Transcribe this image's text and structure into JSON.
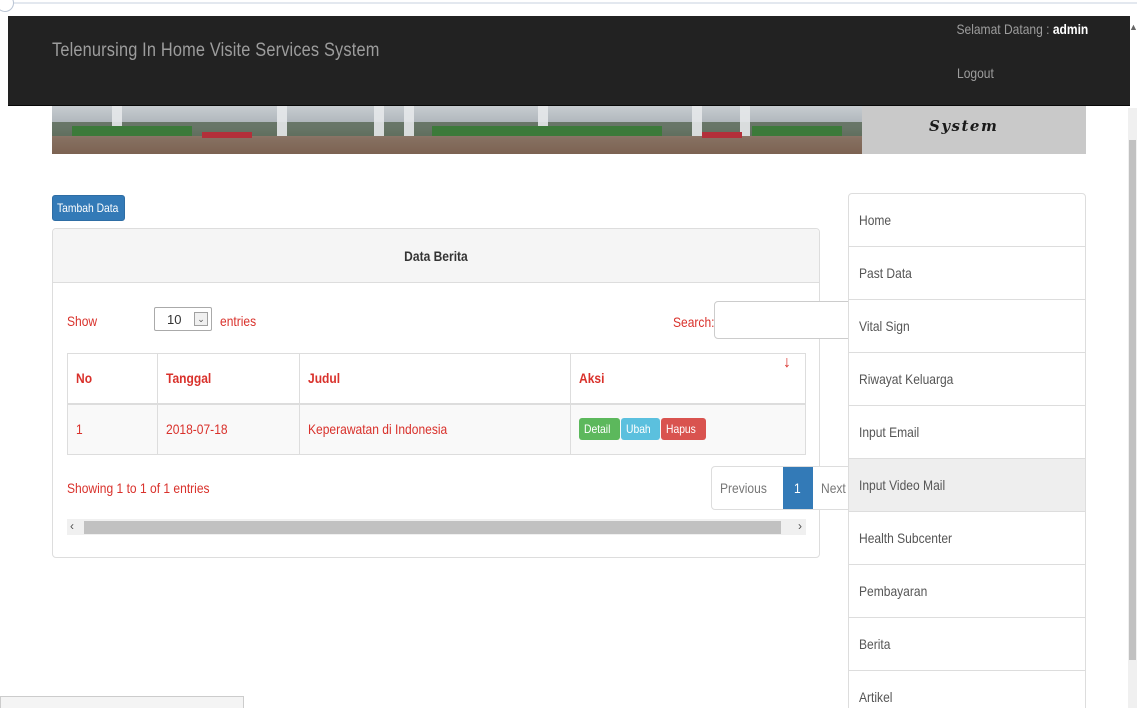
{
  "header": {
    "brand": "Telenursing In Home Visite Services System",
    "welcome_prefix": "Selamat Datang :",
    "username": "admin",
    "logout": "Logout"
  },
  "banner": {
    "system_text": "System"
  },
  "actions": {
    "add_button": "Tambah Data"
  },
  "panel": {
    "title": "Data Berita"
  },
  "datatable": {
    "show_label": "Show",
    "page_length": "10",
    "entries_label": "entries",
    "search_label": "Search:",
    "search_value": "",
    "columns": [
      "No",
      "Tanggal",
      "Judul",
      "Aksi"
    ],
    "rows": [
      {
        "no": "1",
        "tanggal": "2018-07-18",
        "judul": "Keperawatan di Indonesia",
        "actions": [
          "Detail",
          "Ubah",
          "Hapus"
        ]
      }
    ],
    "info": "Showing 1 to 1 of 1 entries",
    "pagination": {
      "previous": "Previous",
      "current": "1",
      "next": "Next"
    }
  },
  "sidebar": {
    "items": [
      {
        "label": "Home"
      },
      {
        "label": "Past Data"
      },
      {
        "label": "Vital Sign"
      },
      {
        "label": "Riwayat Keluarga"
      },
      {
        "label": "Input Email"
      },
      {
        "label": "Input Video Mail"
      },
      {
        "label": "Health Subcenter"
      },
      {
        "label": "Pembayaran"
      },
      {
        "label": "Berita"
      },
      {
        "label": "Artikel"
      }
    ],
    "active_item": "Input Video Mail"
  },
  "colors": {
    "navbar": "#222222",
    "primary": "#337ab7",
    "success": "#5cb85c",
    "info": "#5bc0de",
    "danger": "#d9534f",
    "text_red": "#d9312b"
  },
  "icons": {
    "sort": "sort-arrow-icon",
    "select_arrow": "chevron-down-icon"
  }
}
